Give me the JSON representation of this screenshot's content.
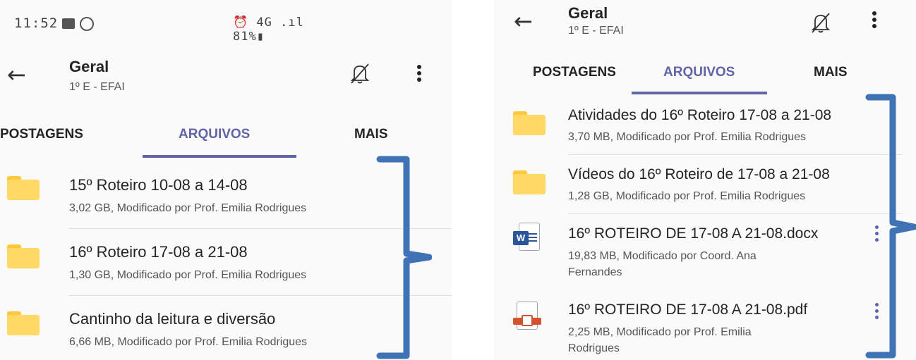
{
  "left": {
    "status_bar": {
      "time": "11:52",
      "indicators": "⏰ 4G .ıl 81%▮"
    },
    "header": {
      "back_icon": "arrow-left-icon",
      "title": "Geral",
      "subtitle": "1º E - EFAI",
      "mute_icon": "bell-off-icon",
      "more_icon": "more-vertical-icon"
    },
    "tabs": [
      {
        "label": "POSTAGENS",
        "active": false
      },
      {
        "label": "ARQUIVOS",
        "active": true
      },
      {
        "label": "MAIS",
        "active": false
      }
    ],
    "files": [
      {
        "icon": "folder-icon",
        "name": "15º Roteiro 10-08 a 14-08",
        "meta": "3,02 GB, Modificado por Prof. Emilia Rodrigues"
      },
      {
        "icon": "folder-icon",
        "name": "16º Roteiro 17-08 a 21-08",
        "meta": "1,30 GB, Modificado por Prof. Emilia Rodrigues"
      },
      {
        "icon": "folder-icon",
        "name": "Cantinho da leitura e diversão",
        "meta": "6,66 MB, Modificado por Prof. Emilia Rodrigues"
      }
    ]
  },
  "right": {
    "header": {
      "back_icon": "arrow-left-icon",
      "title": "Geral",
      "subtitle": "1º E - EFAI",
      "mute_icon": "bell-off-icon",
      "more_icon": "more-vertical-icon"
    },
    "tabs": [
      {
        "label": "POSTAGENS",
        "active": false
      },
      {
        "label": "ARQUIVOS",
        "active": true
      },
      {
        "label": "MAIS",
        "active": false
      }
    ],
    "files": [
      {
        "icon": "folder-icon",
        "name": "Atividades do 16º Roteiro 17-08 a 21-08",
        "meta": "3,70 MB, Modificado por Prof. Emilia Rodrigues"
      },
      {
        "icon": "folder-icon",
        "name": "Vídeos do 16º Roteiro de 17-08 a 21-08",
        "meta": "1,28 GB, Modificado por Prof. Emilia Rodrigues"
      },
      {
        "icon": "word-icon",
        "name": "16º ROTEIRO DE 17-08 A 21-08.docx",
        "meta": "19,83 MB, Modificado por Coord. Ana Fernandes",
        "word_letter": "W"
      },
      {
        "icon": "pdf-icon",
        "name": "16º ROTEIRO DE 17-08 A 21-08.pdf",
        "meta": "2,25 MB, Modificado por Prof. Emilia Rodrigues"
      }
    ]
  },
  "colors": {
    "accent": "#6264a7",
    "bracket": "#3f73b5",
    "folder": "#ffd966",
    "word": "#2b579a",
    "pdf": "#d35230"
  }
}
